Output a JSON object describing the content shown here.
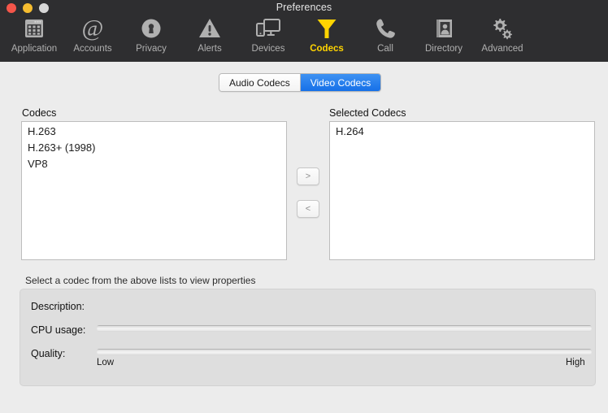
{
  "window": {
    "title": "Preferences",
    "traffic_lights": [
      {
        "name": "close",
        "color": "#f5564a"
      },
      {
        "name": "minimize",
        "color": "#f6bd30"
      },
      {
        "name": "zoom",
        "color": "#d7d7d7"
      }
    ]
  },
  "toolbar": {
    "active_item": "Codecs",
    "active_color": "#ffd400",
    "inactive_color": "#b0b0b0",
    "background": "#2e2e30",
    "items": [
      {
        "label": "Application",
        "icon": "calendar-window-icon"
      },
      {
        "label": "Accounts",
        "icon": "at-sign-icon"
      },
      {
        "label": "Privacy",
        "icon": "lock-circle-icon"
      },
      {
        "label": "Alerts",
        "icon": "warning-triangle-icon"
      },
      {
        "label": "Devices",
        "icon": "monitor-phone-icon"
      },
      {
        "label": "Codecs",
        "icon": "funnel-filter-icon"
      },
      {
        "label": "Call",
        "icon": "phone-handset-icon"
      },
      {
        "label": "Directory",
        "icon": "contact-card-icon"
      },
      {
        "label": "Advanced",
        "icon": "gears-icon"
      }
    ]
  },
  "segmented_control": {
    "selected": "Video Codecs",
    "selected_color": "#1670e8",
    "options": [
      {
        "label": "Audio Codecs",
        "selected": false
      },
      {
        "label": "Video Codecs",
        "selected": true
      }
    ]
  },
  "main": {
    "available": {
      "label": "Codecs",
      "items": [
        "H.263",
        "H.263+ (1998)",
        "VP8"
      ]
    },
    "selected": {
      "label": "Selected Codecs",
      "items": [
        "H.264"
      ]
    },
    "transfer": {
      "add_label": ">",
      "remove_label": "<"
    }
  },
  "properties": {
    "hint": "Select a codec from the above lists to view properties",
    "description_label": "Description:",
    "description_value": "",
    "cpu_label": "CPU usage:",
    "cpu_value": "",
    "quality_label": "Quality:",
    "quality_value": "",
    "scale_low": "Low",
    "scale_high": "High"
  }
}
